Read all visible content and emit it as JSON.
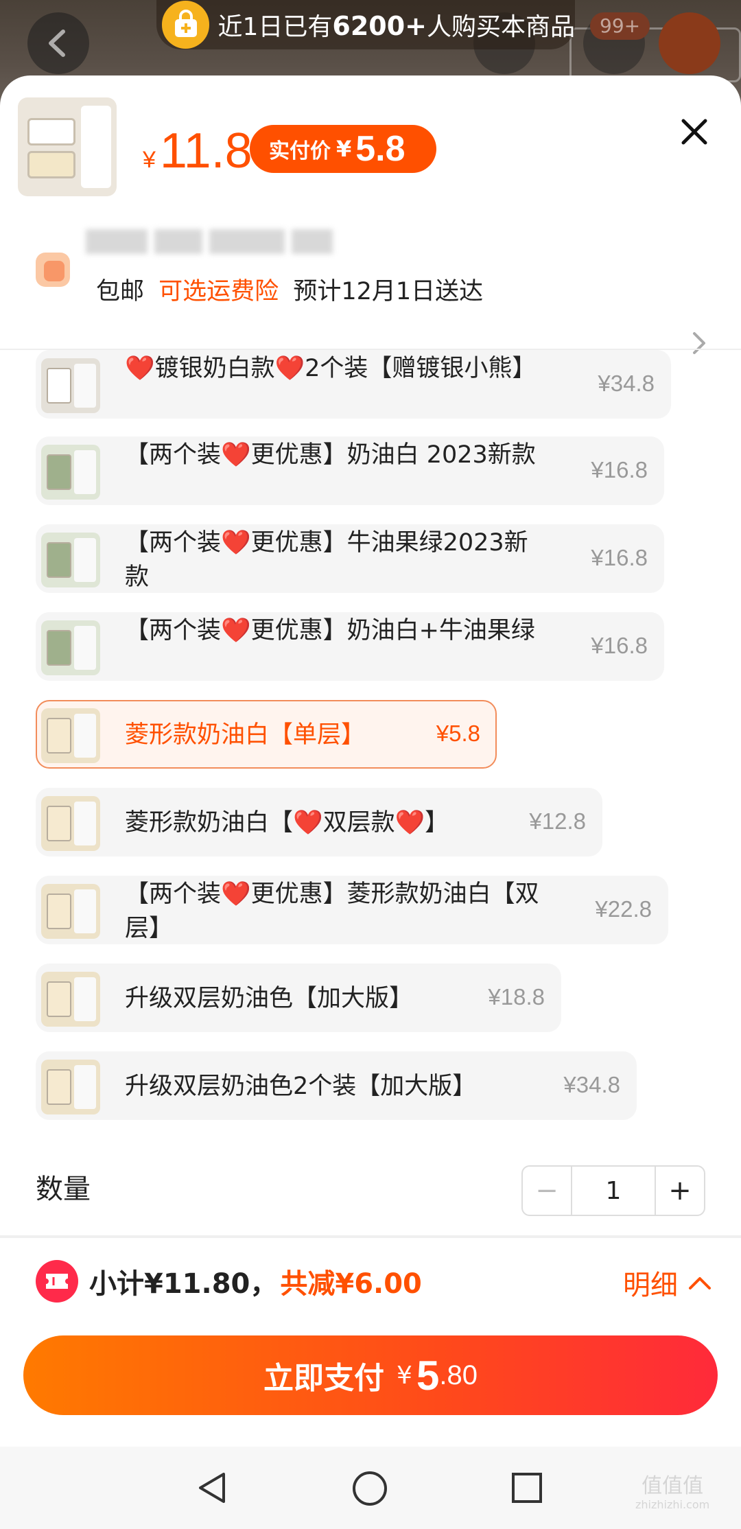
{
  "banner": {
    "prefix": "近1日已有",
    "count": "6200+",
    "suffix": "人购买本商品"
  },
  "background": {
    "cart_badge": "99+"
  },
  "header": {
    "currency": "¥",
    "original_price": "11.8",
    "pay_label": "实付价",
    "pay_currency": "¥",
    "pay_price": "5.8"
  },
  "shipping": {
    "free": "包邮",
    "insurance": "可选运费险",
    "eta": "预计12月1日送达"
  },
  "variants": [
    {
      "name": "❤️镀银奶白款❤️2个装【赠镀银小熊】",
      "price": "¥34.8",
      "selected": false
    },
    {
      "name": "【两个装❤️更优惠】奶油白 2023新款",
      "price": "¥16.8",
      "selected": false
    },
    {
      "name": "【两个装❤️更优惠】牛油果绿2023新款",
      "price": "¥16.8",
      "selected": false
    },
    {
      "name": "【两个装❤️更优惠】奶油白+牛油果绿",
      "price": "¥16.8",
      "selected": false
    },
    {
      "name": "菱形款奶油白【单层】",
      "price": "¥5.8",
      "selected": true
    },
    {
      "name": "菱形款奶油白【❤️双层款❤️】",
      "price": "¥12.8",
      "selected": false
    },
    {
      "name": "【两个装❤️更优惠】菱形款奶油白【双层】",
      "price": "¥22.8",
      "selected": false
    },
    {
      "name": "升级双层奶油色【加大版】",
      "price": "¥18.8",
      "selected": false
    },
    {
      "name": "升级双层奶油色2个装【加大版】",
      "price": "¥34.8",
      "selected": false
    }
  ],
  "quantity": {
    "label": "数量",
    "minus": "−",
    "value": "1",
    "plus": "+"
  },
  "summary": {
    "subtotal": "小计¥11.80，",
    "discount": "共减¥6.00",
    "detail": "明细"
  },
  "pay_button": {
    "label": "立即支付",
    "currency": "¥",
    "integer": "5",
    "decimal": ".80"
  },
  "watermark": {
    "text": "值值值",
    "url": "zhizhizhi.com"
  },
  "colors": {
    "accent": "#ff5000",
    "selected_border": "#f28c5a",
    "pay_gradient_start": "#ff7a00",
    "pay_gradient_end": "#ff2a3a"
  }
}
